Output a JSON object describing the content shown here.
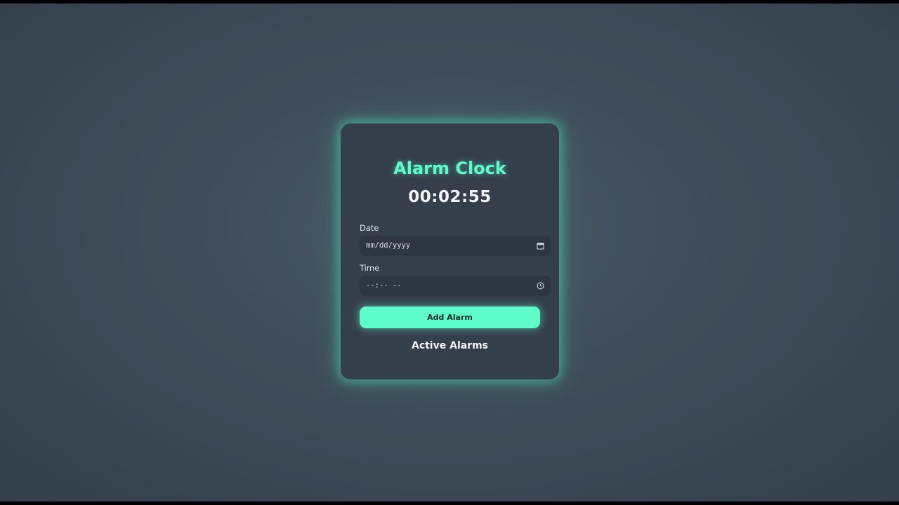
{
  "app": {
    "title": "Alarm Clock",
    "current_time": "00:02:55"
  },
  "form": {
    "date_label": "Date",
    "date_placeholder": "mm/dd/yyyy",
    "time_label": "Time",
    "time_placeholder": "--:-- --",
    "add_button_label": "Add Alarm"
  },
  "alarms": {
    "section_title": "Active Alarms",
    "items": []
  },
  "colors": {
    "accent": "#5efcc8",
    "card_bg": "#353f4c",
    "input_bg": "#2d3641"
  },
  "icons": {
    "date_icon": "calendar-icon",
    "time_icon": "clock-icon"
  }
}
